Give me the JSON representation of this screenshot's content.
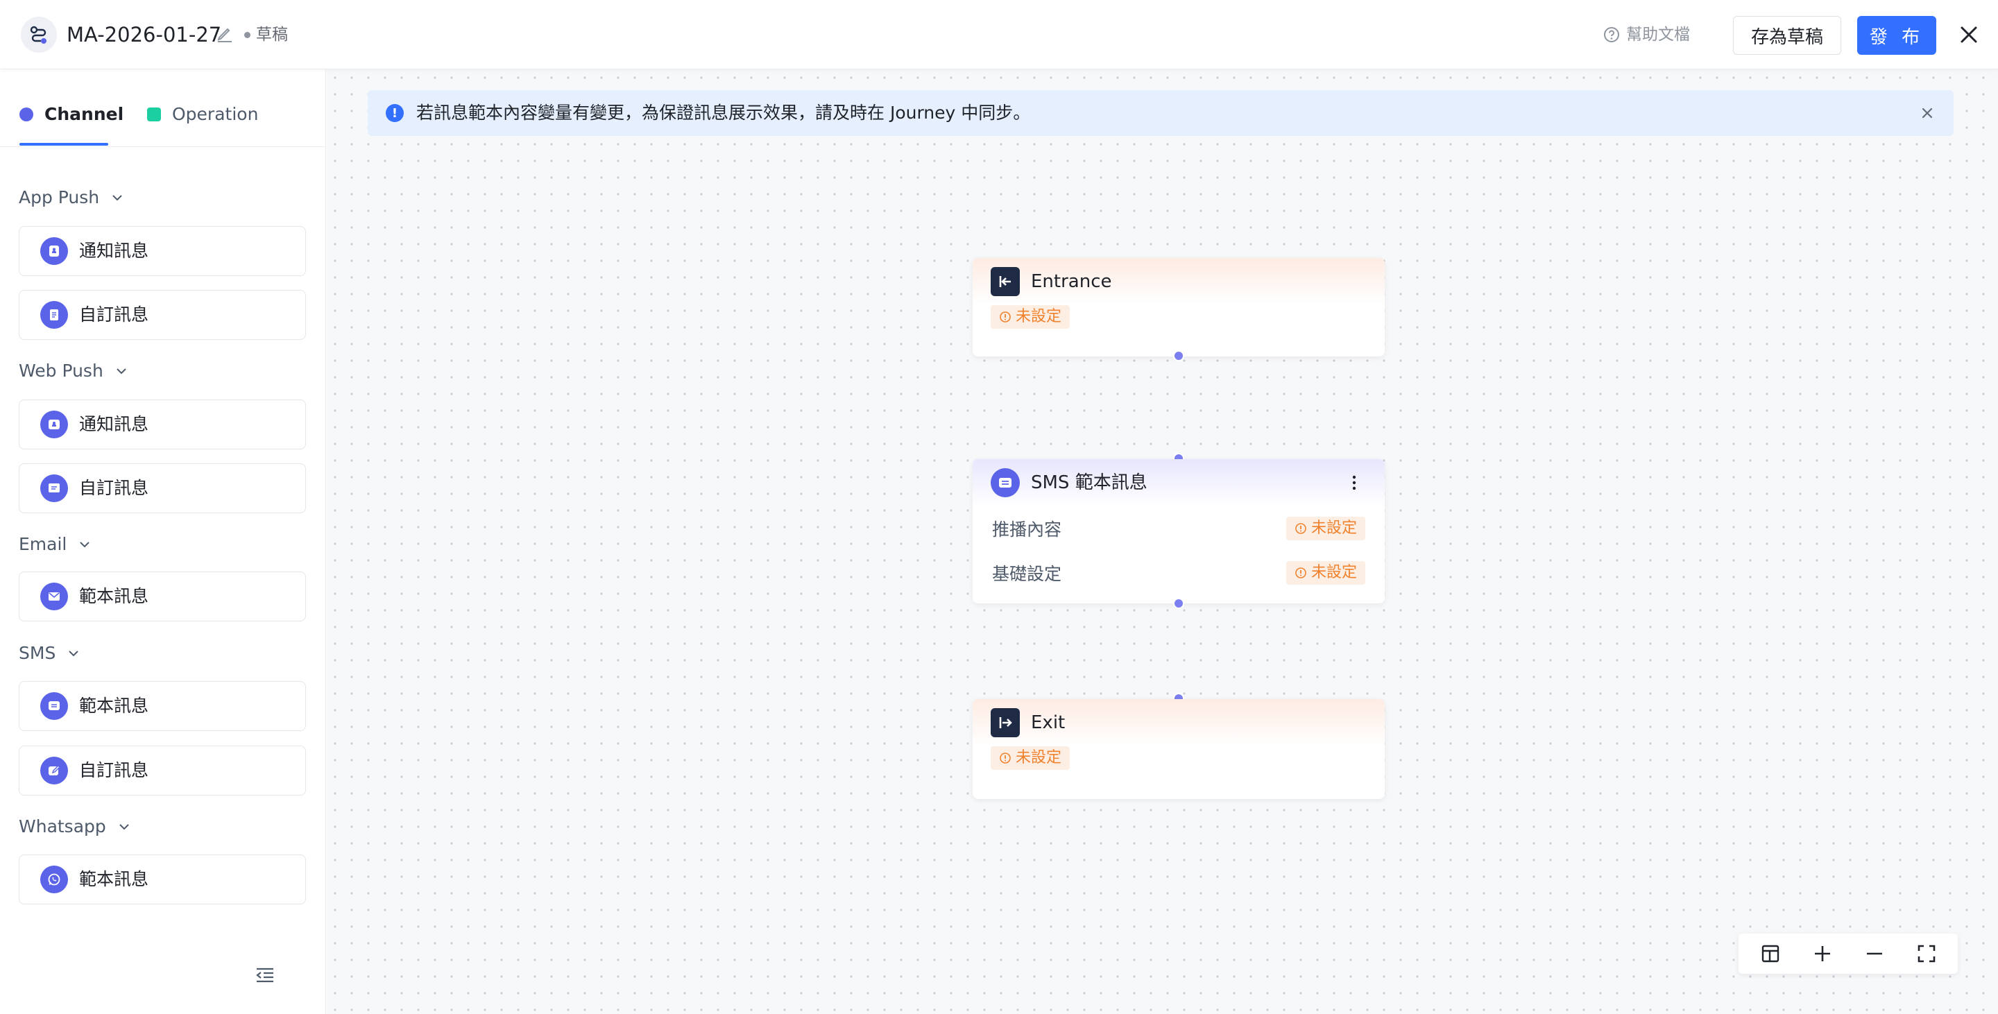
{
  "header": {
    "title": "MA-2026-01-27",
    "status": "草稿",
    "help_label": "幫助文檔",
    "save_draft_label": "存為草稿",
    "publish_label": "發 布"
  },
  "sidebar": {
    "tabs": [
      {
        "label": "Channel",
        "color": "#5b63e8",
        "active": true
      },
      {
        "label": "Operation",
        "color": "#1ccfa0",
        "active": false
      }
    ],
    "groups": [
      {
        "title": "App Push",
        "items": [
          {
            "label": "通知訊息",
            "icon": "bell-icon"
          },
          {
            "label": "自訂訊息",
            "icon": "document-icon"
          }
        ]
      },
      {
        "title": "Web Push",
        "items": [
          {
            "label": "通知訊息",
            "icon": "bell-icon"
          },
          {
            "label": "自訂訊息",
            "icon": "message-icon"
          }
        ]
      },
      {
        "title": "Email",
        "items": [
          {
            "label": "範本訊息",
            "icon": "mail-icon"
          }
        ]
      },
      {
        "title": "SMS",
        "items": [
          {
            "label": "範本訊息",
            "icon": "chat-icon"
          },
          {
            "label": "自訂訊息",
            "icon": "edit-chat-icon"
          }
        ]
      },
      {
        "title": "Whatsapp",
        "items": [
          {
            "label": "範本訊息",
            "icon": "whatsapp-icon"
          }
        ]
      }
    ]
  },
  "banner": {
    "text": "若訊息範本內容變量有變更，為保證訊息展示效果，請及時在 Journey 中同步。"
  },
  "nodes": {
    "entrance": {
      "title": "Entrance",
      "status": "未設定"
    },
    "sms": {
      "title": "SMS 範本訊息",
      "rows": [
        {
          "label": "推播內容",
          "status": "未設定"
        },
        {
          "label": "基礎設定",
          "status": "未設定"
        }
      ]
    },
    "exit": {
      "title": "Exit",
      "status": "未設定"
    }
  },
  "colors": {
    "accent": "#3370ff",
    "node_icon": "#5b63e8",
    "warning": "#f0822d",
    "port": "#7b7ff0"
  }
}
